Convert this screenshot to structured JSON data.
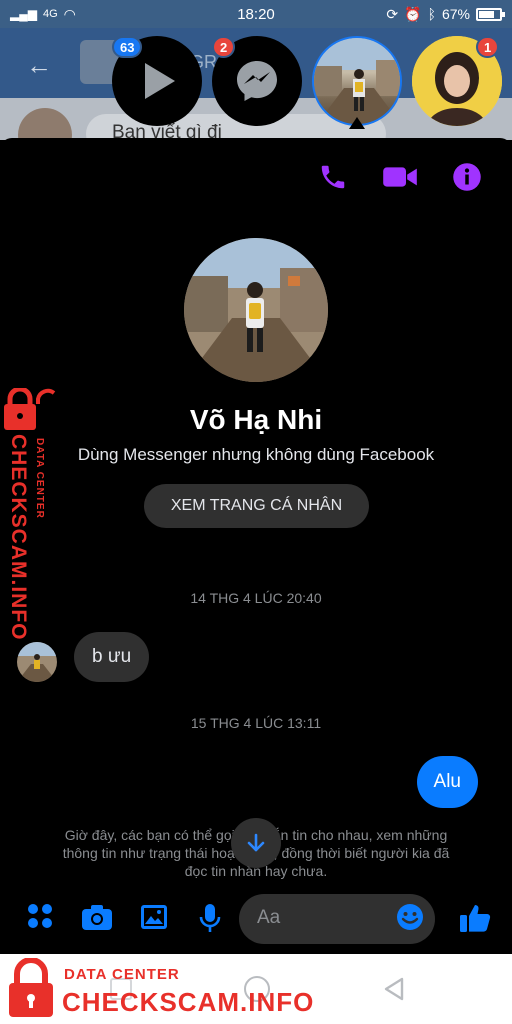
{
  "status_bar": {
    "signal": "4G",
    "time": "18:20",
    "battery": "67%",
    "battery_level": 0.67
  },
  "background_app": {
    "header_text": "GR",
    "composer_placeholder": "Bạn viết gì đi"
  },
  "chat_heads": [
    {
      "name": "video-chathead",
      "badge": "63",
      "badge_color": "#1877f2"
    },
    {
      "name": "messenger-chathead",
      "badge": "2",
      "badge_color": "#e8453c"
    },
    {
      "name": "active-contact-chathead",
      "badge": ""
    },
    {
      "name": "girl-contact-chathead",
      "badge": "1",
      "badge_color": "#e8453c"
    }
  ],
  "conversation": {
    "contact_name": "Võ Hạ Nhi",
    "contact_subtitle": "Dùng Messenger nhưng không dùng Facebook",
    "view_profile_label": "XEM TRANG CÁ NHÂN",
    "timestamp_1": "14 THG 4 LÚC 20:40",
    "incoming_message": "b ưu",
    "timestamp_2": "15 THG 4 LÚC 13:11",
    "outgoing_message": "Alu",
    "notice": "Giờ đây, các bạn có thể gọi và nhắn tin cho nhau, xem những thông tin như trạng thái hoạt động, đồng thời biết người kia đã đọc tin nhắn hay chưa."
  },
  "composer": {
    "placeholder": "Aa",
    "icons": [
      "apps-icon",
      "camera-icon",
      "gallery-icon",
      "microphone-icon",
      "emoji-icon",
      "like-icon"
    ]
  },
  "colors": {
    "accent_purple": "#a033ff",
    "messenger_blue": "#0a7cff",
    "watermark_red": "#e8302a"
  },
  "watermark": {
    "brand": "CHECKSCAM.INFO",
    "subtitle": "DATA CENTER"
  }
}
